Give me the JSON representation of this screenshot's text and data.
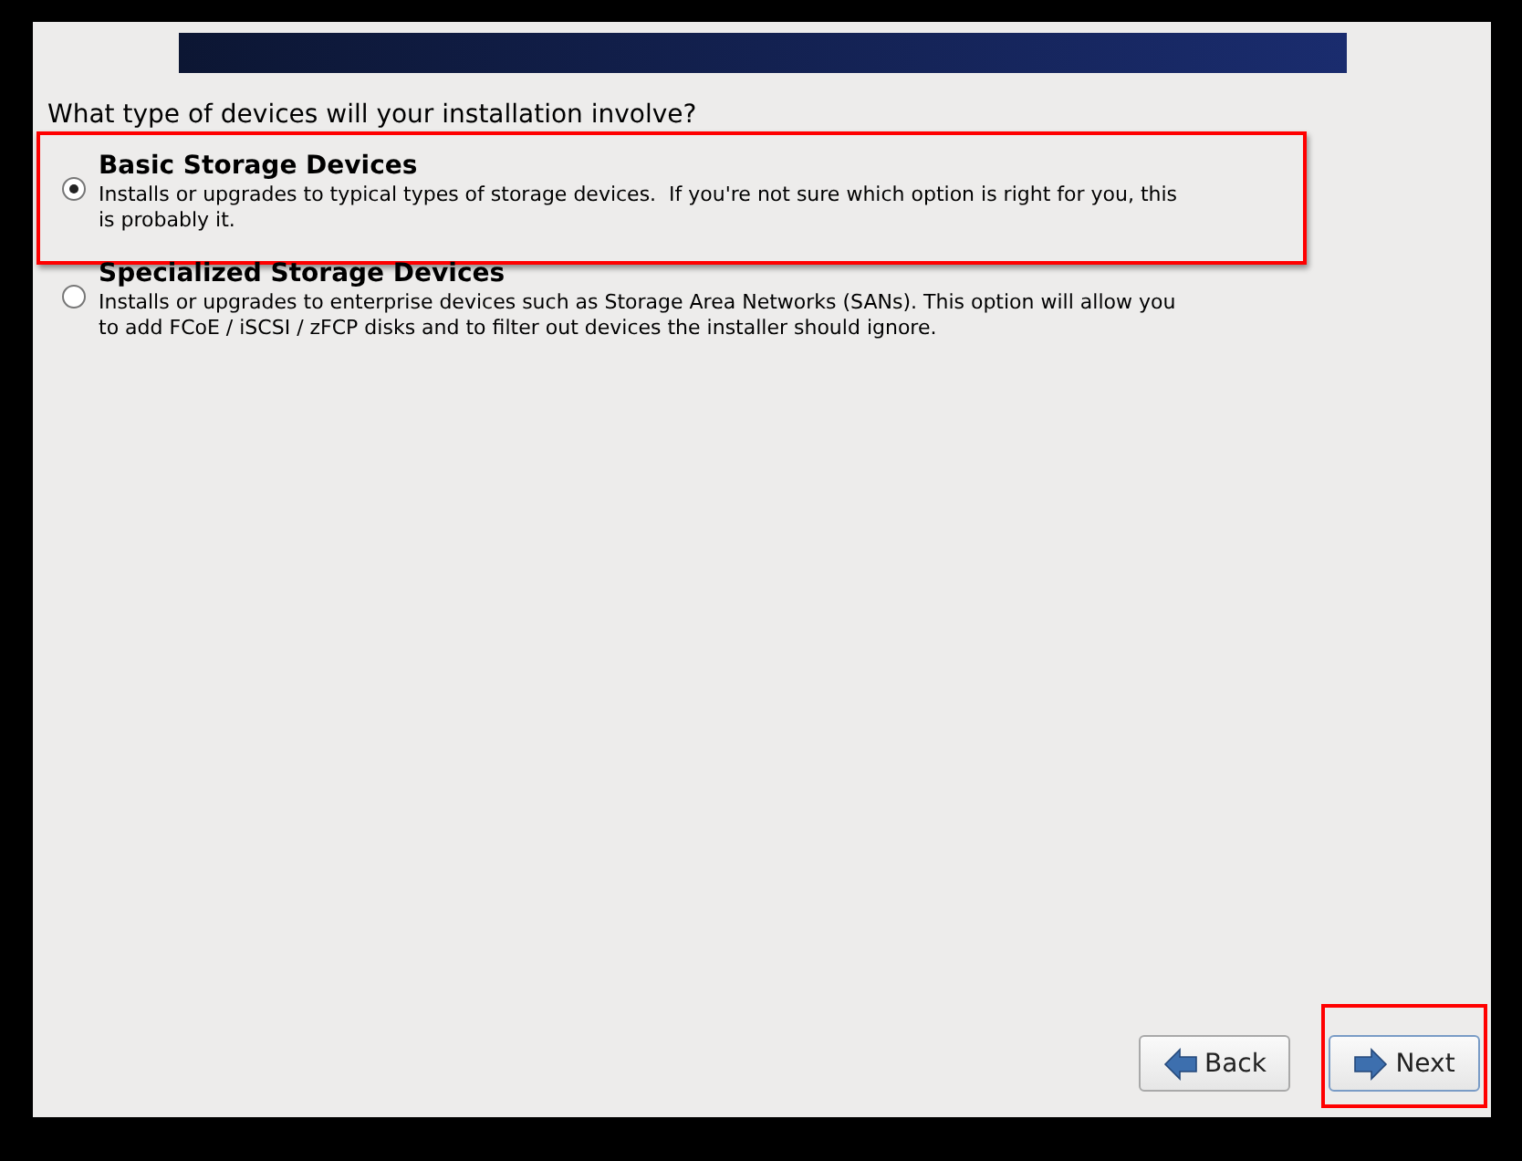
{
  "question": "What type of devices will your installation involve?",
  "options": [
    {
      "title": "Basic Storage Devices",
      "description": "Installs or upgrades to typical types of storage devices.  If you're not sure which option is right for you, this is probably it.",
      "selected": true,
      "highlighted": true
    },
    {
      "title": "Specialized Storage Devices",
      "description": "Installs or upgrades to enterprise devices such as Storage Area Networks (SANs). This option will allow you to add FCoE / iSCSI / zFCP disks and to filter out devices the installer should ignore.",
      "selected": false,
      "highlighted": false
    }
  ],
  "buttons": [
    {
      "kind": "back",
      "label": "Back",
      "highlighted": false
    },
    {
      "kind": "next",
      "label": "Next",
      "highlighted": true
    }
  ]
}
